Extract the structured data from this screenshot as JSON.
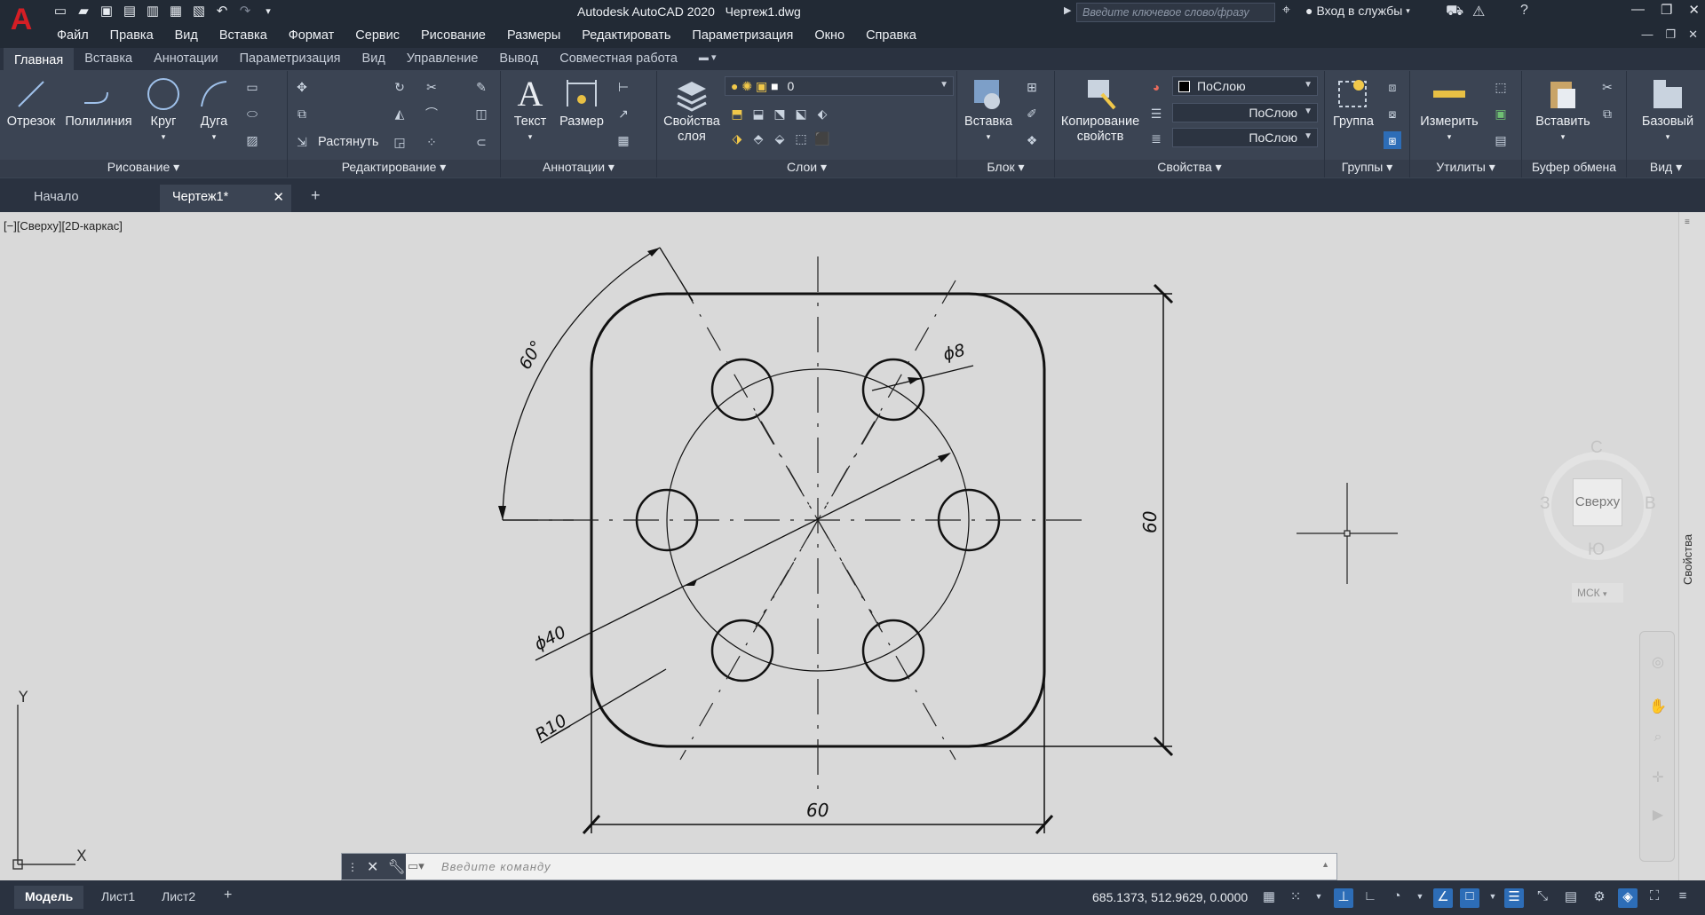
{
  "app": {
    "title": "Autodesk AutoCAD 2020",
    "document": "Чертеж1.dwg",
    "logo": "A"
  },
  "search": {
    "placeholder": "Введите ключевое слово/фразу"
  },
  "signin": {
    "label": "Вход в службы"
  },
  "menu": [
    "Файл",
    "Правка",
    "Вид",
    "Вставка",
    "Формат",
    "Сервис",
    "Рисование",
    "Размеры",
    "Редактировать",
    "Параметризация",
    "Окно",
    "Справка"
  ],
  "ribbon_tabs": [
    "Главная",
    "Вставка",
    "Аннотации",
    "Параметризация",
    "Вид",
    "Управление",
    "Вывод",
    "Совместная работа"
  ],
  "panels": {
    "draw": {
      "title": "Рисование",
      "line": "Отрезок",
      "polyline": "Полилиния",
      "circle": "Круг",
      "arc": "Дуга"
    },
    "modify": {
      "title": "Редактирование",
      "stretch": "Растянуть"
    },
    "annotation": {
      "title": "Аннотации",
      "text": "Текст",
      "dimension": "Размер"
    },
    "layers": {
      "title": "Слои",
      "layer_props_1": "Свойства",
      "layer_props_2": "слоя",
      "current_layer": "0"
    },
    "block": {
      "title": "Блок",
      "insert": "Вставка"
    },
    "properties": {
      "title": "Свойства",
      "match_1": "Копирование",
      "match_2": "свойств",
      "color": "ПоСлою",
      "linetype": "ПоСлою",
      "lineweight": "ПоСлою"
    },
    "groups": {
      "title": "Группы",
      "group": "Группа"
    },
    "utilities": {
      "title": "Утилиты",
      "measure": "Измерить"
    },
    "clipboard": {
      "title": "Буфер обмена",
      "paste": "Вставить"
    },
    "view": {
      "title": "Вид",
      "base": "Базовый"
    }
  },
  "file_tabs": [
    "Начало",
    "Чертеж1*"
  ],
  "viewport_label": "[−][Сверху][2D-каркас]",
  "drawing": {
    "dim_width": "60",
    "dim_height": "60",
    "dim_hole": "ϕ8",
    "dim_bolt_circle": "ϕ40",
    "dim_radius": "R10",
    "dim_angle": "60°"
  },
  "ucs": {
    "x": "X",
    "y": "Y"
  },
  "viewcube": {
    "north": "С",
    "south": "Ю",
    "west": "З",
    "east": "В",
    "face": "Сверху",
    "ucs_menu": "МСК"
  },
  "side_palette": "Свойства",
  "command": {
    "placeholder": "Введите команду"
  },
  "layout_tabs": [
    "Модель",
    "Лист1",
    "Лист2"
  ],
  "status": {
    "coords": "685.1373, 512.9629, 0.0000"
  },
  "colors": {
    "canvas": "#d9d9d9",
    "ribbon": "#3b4453",
    "titlebar": "#222a35",
    "accent": "#2d6db7",
    "logo": "#d51e25"
  }
}
